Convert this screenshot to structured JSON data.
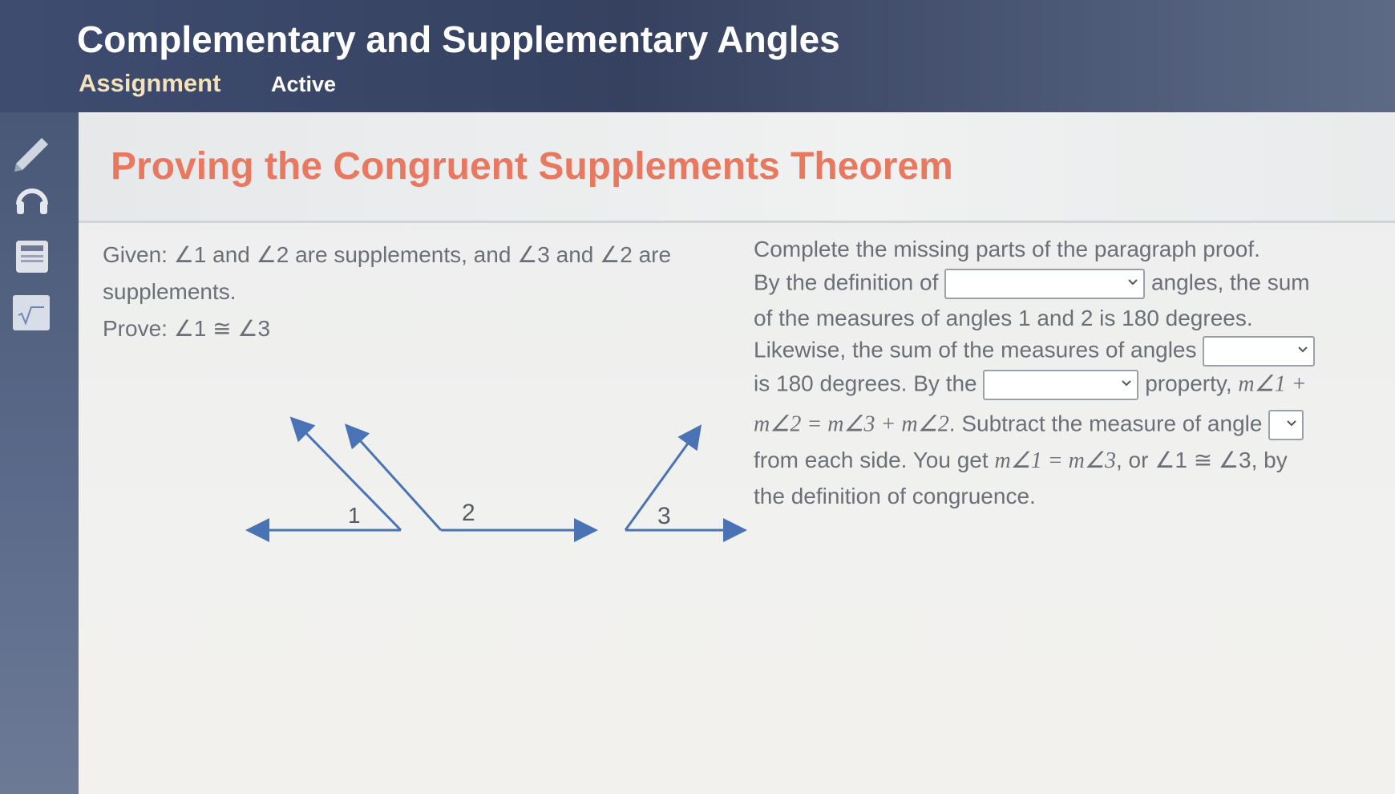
{
  "header": {
    "title": "Complementary and Supplementary Angles",
    "assignment": "Assignment",
    "status": "Active"
  },
  "sidebar": {
    "tools": [
      {
        "icon": "pencil-icon"
      },
      {
        "icon": "headphones-icon"
      },
      {
        "icon": "calculator-icon"
      },
      {
        "icon": "formula-icon"
      }
    ]
  },
  "lesson": {
    "title": "Proving the Congruent Supplements Theorem"
  },
  "problem": {
    "given_line1": "Given: ∠1 and ∠2 are supplements, and ∠3 and ∠2 are",
    "given_line2": "supplements.",
    "prove": "Prove: ∠1 ≅ ∠3",
    "angle_labels": [
      "1",
      "2",
      "3"
    ]
  },
  "proof": {
    "instruction": "Complete the missing parts of the paragraph proof.",
    "l2_before": "By the definition of",
    "l2_after": "angles, the sum",
    "l3": "of the measures of angles 1 and 2 is 180 degrees.",
    "l4": "Likewise, the sum of the measures of angles",
    "l5_before": "is 180 degrees. By the",
    "l5_after": "property,",
    "l5_math": "m∠1 +",
    "l6_math": "m∠2 = m∠3 + m∠2",
    "l6_text": ". Subtract the measure of angle",
    "l7_text": "from each side. You get",
    "l7_math": "m∠1 = m∠3",
    "l7_or": ", or",
    "l7_cong": "∠1 ≅ ∠3",
    "l7_by": ", by",
    "l8": "the definition of congruence."
  },
  "colors": {
    "title_accent": "#e87860",
    "diagram_line": "#4a73b5",
    "text": "#6b6f78"
  }
}
